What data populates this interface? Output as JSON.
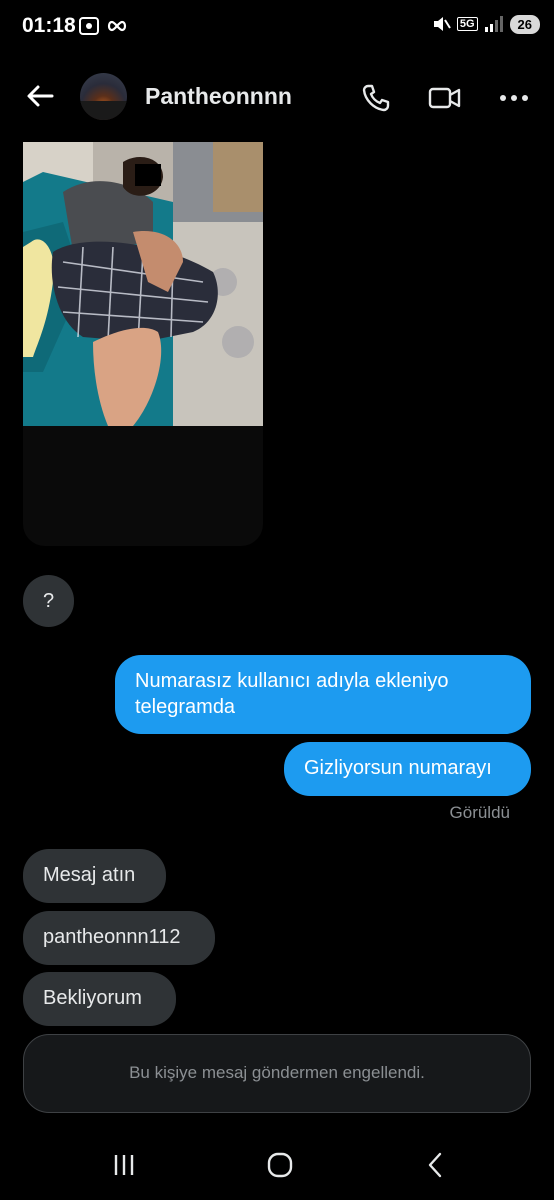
{
  "status_bar": {
    "time": "01:18",
    "network": "5G",
    "battery": "26"
  },
  "header": {
    "username": "Pantheonnnn",
    "icons": [
      "back-arrow-icon",
      "phone-icon",
      "video-icon",
      "more-icon"
    ]
  },
  "messages": [
    {
      "side": "in",
      "text": "?"
    },
    {
      "side": "out",
      "text": "Numarasız kullanıcı adıyla ekleniyo telegramda"
    },
    {
      "side": "out",
      "text": "Gizliyorsun numarayı"
    },
    {
      "side": "in",
      "text": "Mesaj atın"
    },
    {
      "side": "in",
      "text": "pantheonnn112"
    },
    {
      "side": "in",
      "text": "Bekliyorum"
    }
  ],
  "seen_label": "Görüldü",
  "blocked_notice": "Bu kişiye mesaj göndermen engellendi.",
  "colors": {
    "background": "#000000",
    "incoming_bubble": "#2f3336",
    "outgoing_bubble": "#1d9bf0",
    "muted_text": "#8b8f93"
  }
}
